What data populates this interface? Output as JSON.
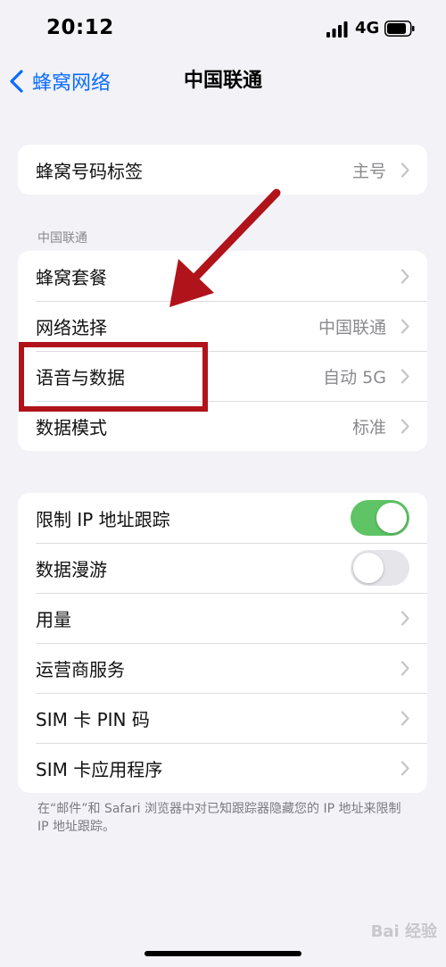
{
  "status_bar": {
    "time": "20:12",
    "network": "4G"
  },
  "nav": {
    "back_label": "蜂窝网络",
    "title": "中国联通"
  },
  "group1": {
    "rows": [
      {
        "label": "蜂窝号码标签",
        "value": "主号"
      }
    ]
  },
  "group2": {
    "header": "中国联通",
    "rows": [
      {
        "label": "蜂窝套餐",
        "value": ""
      },
      {
        "label": "网络选择",
        "value": "中国联通"
      },
      {
        "label": "语音与数据",
        "value": "自动 5G"
      },
      {
        "label": "数据模式",
        "value": "标准"
      }
    ]
  },
  "group3": {
    "rows": [
      {
        "label": "限制 IP 地址跟踪",
        "toggle": true
      },
      {
        "label": "数据漫游",
        "toggle": false
      },
      {
        "label": "用量"
      },
      {
        "label": "运营商服务"
      },
      {
        "label": "SIM 卡 PIN 码"
      },
      {
        "label": "SIM 卡应用程序"
      }
    ],
    "footer": "在“邮件”和 Safari 浏览器中对已知跟踪器隐藏您的 IP 地址来限制 IP 地址跟踪。"
  },
  "annotation": {
    "color": "#b0131a"
  },
  "watermark": "Bai 经验",
  "colors": {
    "accent": "#0a6cff",
    "toggle_on": "#5ec466",
    "background": "#f2f2f7"
  }
}
